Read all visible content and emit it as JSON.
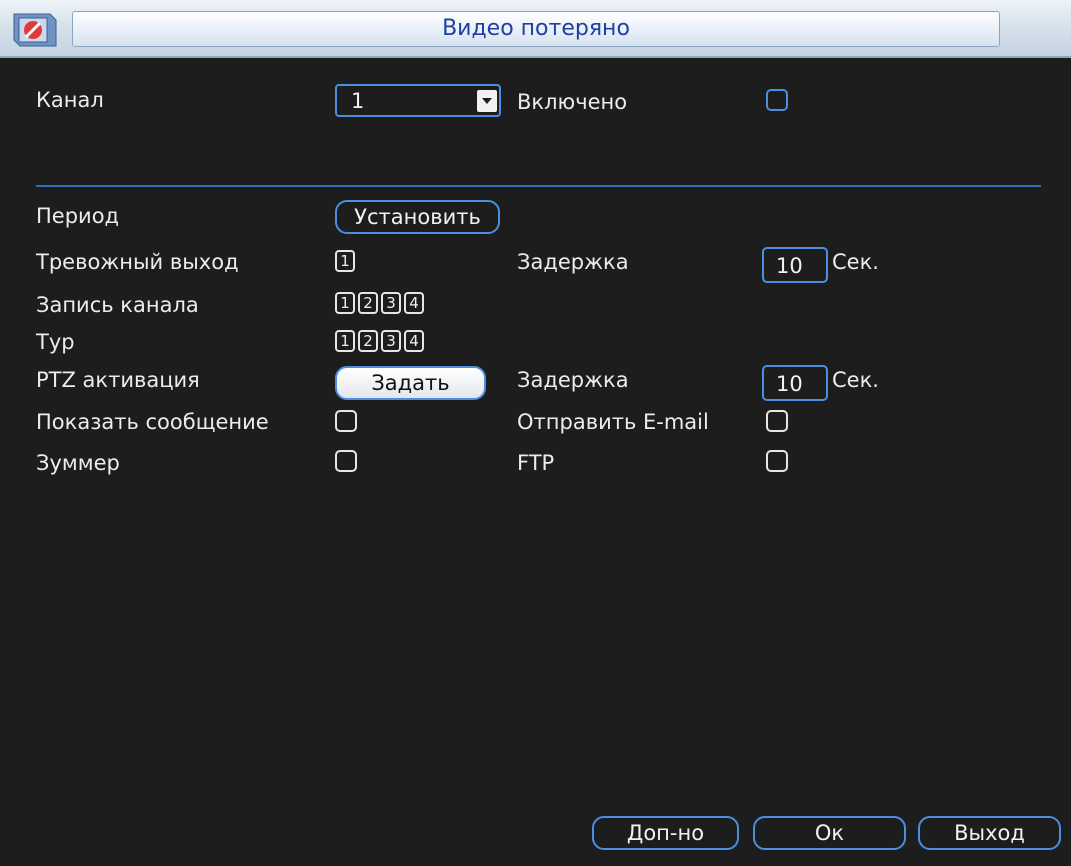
{
  "window": {
    "title": "Видео потеряно"
  },
  "channel": {
    "label": "Канал",
    "value": "1"
  },
  "enabled": {
    "label": "Включено",
    "checked": false
  },
  "period": {
    "label": "Период",
    "button": "Установить"
  },
  "alarm_output": {
    "label": "Тревожный выход",
    "channels": [
      "1"
    ]
  },
  "delay1": {
    "label": "Задержка",
    "value": "10",
    "unit": "Сек."
  },
  "record_channel": {
    "label": "Запись канала",
    "channels": [
      "1",
      "2",
      "3",
      "4"
    ]
  },
  "tour": {
    "label": "Тур",
    "channels": [
      "1",
      "2",
      "3",
      "4"
    ]
  },
  "ptz": {
    "label": "PTZ активация",
    "button": "Задать"
  },
  "delay2": {
    "label": "Задержка",
    "value": "10",
    "unit": "Сек."
  },
  "show_message": {
    "label": "Показать сообщение",
    "checked": false
  },
  "send_email": {
    "label": "Отправить E-mail",
    "checked": false
  },
  "buzzer": {
    "label": "Зуммер",
    "checked": false
  },
  "ftp": {
    "label": "FTP",
    "checked": false
  },
  "footer": {
    "advanced": "Доп-но",
    "ok": "Ок",
    "exit": "Выход"
  },
  "colors": {
    "accent": "#4a8fe0",
    "title_text": "#1f3fa6",
    "background": "#1d1d1d"
  }
}
